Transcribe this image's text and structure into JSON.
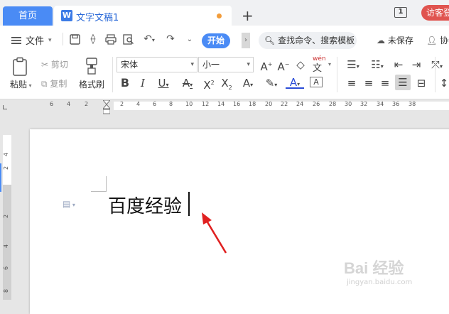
{
  "tabs": {
    "home": "首页",
    "doc_title": "文字文稿1",
    "new_tab": "+"
  },
  "topright": {
    "page_count": "1",
    "visitor": "访客登"
  },
  "menu": {
    "file": "文件",
    "start_tab": "开始",
    "search": "查找命令、搜索模板",
    "unsaved": "未保存",
    "collab": "协作"
  },
  "ribbon": {
    "paste": "粘贴",
    "cut": "剪切",
    "copy": "复制",
    "format_painter": "格式刷",
    "font_name": "宋体",
    "font_size": "小一",
    "pinyin": "wén"
  },
  "ruler": {
    "h_ticks": [
      "6",
      "4",
      "2",
      "2",
      "4",
      "6",
      "8",
      "10",
      "12",
      "14",
      "16",
      "18",
      "20",
      "22",
      "24",
      "26",
      "28",
      "30",
      "32",
      "34",
      "36",
      "38"
    ],
    "v_ticks": [
      "4",
      "2",
      "2",
      "4",
      "6",
      "8"
    ]
  },
  "document": {
    "text": "百度经验"
  },
  "watermark": {
    "main": "Bai 经验",
    "sub": "jingyan.baidu.com"
  },
  "colors": {
    "accent": "#4a8bf5",
    "visitor": "#e0544f",
    "arrow": "#e02020"
  }
}
